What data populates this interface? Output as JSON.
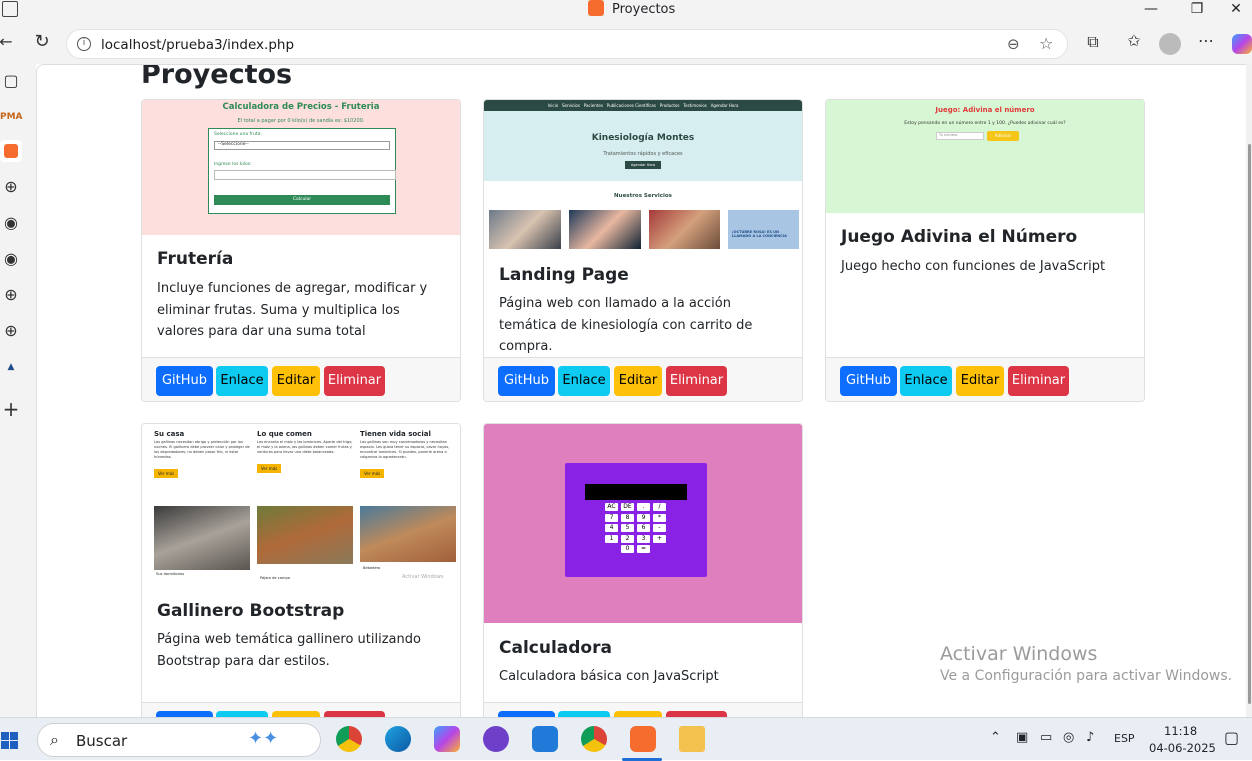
{
  "window": {
    "title": "Proyectos",
    "minimize": "—",
    "maximize": "❐",
    "close": "✕"
  },
  "address": {
    "url": "localhost/prueba3/index.php"
  },
  "page": {
    "heading": "Proyectos"
  },
  "buttons": {
    "github": "GitHub",
    "link": "Enlace",
    "edit": "Editar",
    "delete": "Eliminar"
  },
  "cards": [
    {
      "title": "Frutería",
      "desc": "Incluye funciones de agregar, modificar y eliminar frutas. Suma y multiplica los valores para dar una suma total",
      "thumb": {
        "heading": "Calculadora de Precios - Fruteria",
        "sub": "El total a pagar por 0 kilo(s) de sandía es: $10200.",
        "label1": "Seleccione una fruta:",
        "select": "--Seleccione--",
        "label2": "Ingrese los kilos:",
        "button": "Calcular"
      }
    },
    {
      "title": "Landing Page",
      "desc": "Página web con llamado a la acción temática de kinesiología con carrito de compra.",
      "thumb": {
        "nav": [
          "Inicio",
          "Servicios",
          "Pacientes",
          "Publicaciones Científicas",
          "Productos",
          "Testimonios",
          "Agendar Hora"
        ],
        "heading": "Kinesiología Montes",
        "sub": "Tratamientos rápidos y eficaces",
        "button": "Agendar Hora",
        "section": "Nuestros Servicios",
        "badge": "¡OCTUBRE ROSA! ES UN LLAMADO A LA CONCIENCIA"
      }
    },
    {
      "title": "Juego Adivina el Número",
      "desc": "Juego hecho con funciones de JavaScript",
      "thumb": {
        "heading": "Juego: Adivina el número",
        "sub": "Estoy pensando en un número entre 1 y 100. ¿Puedes adivinar cuál es?",
        "input": "Tu número",
        "button": "Adivinar"
      }
    },
    {
      "title": "Gallinero Bootstrap",
      "desc": "Página web temática gallinero utilizando Bootstrap para dar estilos.",
      "thumb": {
        "cols": [
          {
            "h": "Su casa",
            "t": "Las gallinas necesitan abrigo y protección por las noches. El gallinero debe proveer calor y proteger de los depredadores; no deben pasar frío, ni estar húmedas.",
            "btn": "Ver más",
            "cap": "Sus dormitorios"
          },
          {
            "h": "Lo que comen",
            "t": "Les encanta el maíz y las lombrices. Aparte del trigo, el maíz y la avena, las gallinas deben comer frutas y verduras para llevar una dieta balanceada.",
            "btn": "Ver más",
            "cap": "Pájaro de campo"
          },
          {
            "h": "Tienen vida social",
            "t": "Las gallinas son muy conversadoras y necesitan espacio. Les gusta tener su espacio, cavar hoyos, encontrar lombrices. Si puedes, ponerle arena o colgarnos la agradecerán.",
            "btn": "Ver más",
            "cap": "Bebedero"
          }
        ],
        "wm": "Activar Windows"
      }
    },
    {
      "title": "Calculadora",
      "desc": "Calculadora básica con JavaScript",
      "thumb": {
        "keys": [
          [
            "AC",
            "DE",
            ".",
            "/"
          ],
          [
            "7",
            "8",
            "9",
            "*"
          ],
          [
            "4",
            "5",
            "6",
            "-"
          ],
          [
            "1",
            "2",
            "3",
            "+"
          ],
          [
            "0",
            "="
          ]
        ]
      }
    }
  ],
  "watermark": {
    "line1": "Activar Windows",
    "line2": "Ve a Configuración para activar Windows."
  },
  "taskbar": {
    "search": "Buscar",
    "lang": "ESP",
    "time": "11:18",
    "date": "04-06-2025"
  },
  "colors": {
    "primary": "#0d6efd",
    "info": "#0dcaf0",
    "warning": "#ffc107",
    "danger": "#dc3545"
  }
}
